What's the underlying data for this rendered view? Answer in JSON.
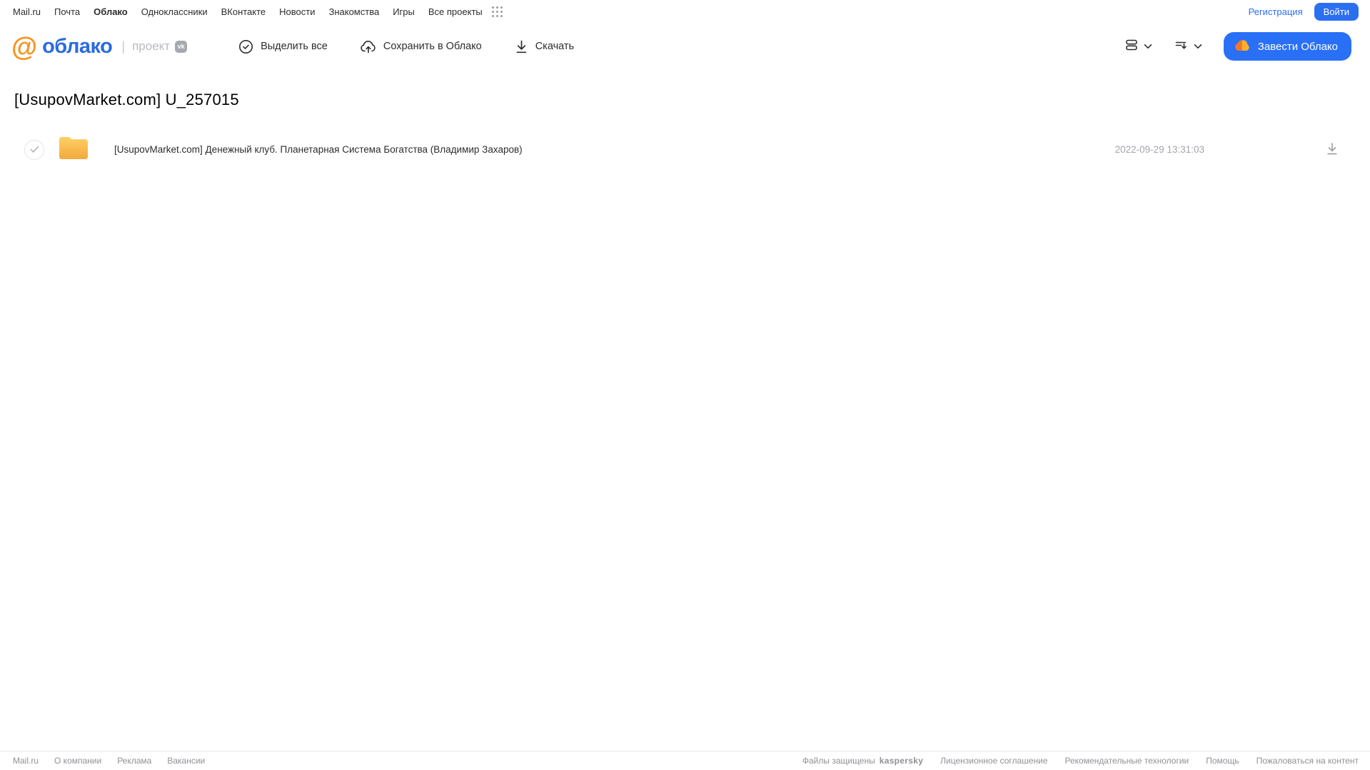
{
  "topnav": {
    "links": [
      "Mail.ru",
      "Почта",
      "Облако",
      "Одноклассники",
      "ВКонтакте",
      "Новости",
      "Знакомства",
      "Игры",
      "Все проекты"
    ],
    "registration_label": "Регистрация",
    "login_label": "Войти"
  },
  "header": {
    "logo_text": "облако",
    "project_label": "проект",
    "vk_badge": "vk",
    "select_all_label": "Выделить все",
    "save_to_cloud_label": "Сохранить в Облако",
    "download_label": "Скачать",
    "cta_label": "Завести Облако"
  },
  "main": {
    "title": "[UsupovMarket.com] U_257015",
    "file": {
      "type": "folder",
      "name": "[UsupovMarket.com] Денежный клуб. Планетарная Система Богатства (Владимир Захаров)",
      "date": "2022-09-29 13:31:03"
    }
  },
  "footer": {
    "left_links": [
      "Mail.ru",
      "О компании",
      "Реклама",
      "Вакансии"
    ],
    "protected_label": "Файлы защищены",
    "kaspersky_label": "kaspersky",
    "right_links": [
      "Лицензионное соглашение",
      "Рекомендательные технологии",
      "Помощь",
      "Пожаловаться на контент"
    ]
  },
  "icons": {
    "apps_grid": "grid-dots-icon",
    "select_all": "check-circle-icon",
    "save": "cloud-upload-icon",
    "download": "download-icon",
    "view": "view-rows-icon",
    "sort": "sort-desc-icon",
    "chevron": "chevron-down-icon",
    "cta_cloud": "cloud-icon",
    "folder": "folder-icon"
  },
  "colors": {
    "accent_blue": "#2970f6",
    "logo_blue": "#2b6cdf",
    "logo_orange": "#f7931e",
    "folder_yellow": "#f5b43c",
    "kaspersky_green": "#00a88e",
    "muted_gray": "#8f9196"
  }
}
